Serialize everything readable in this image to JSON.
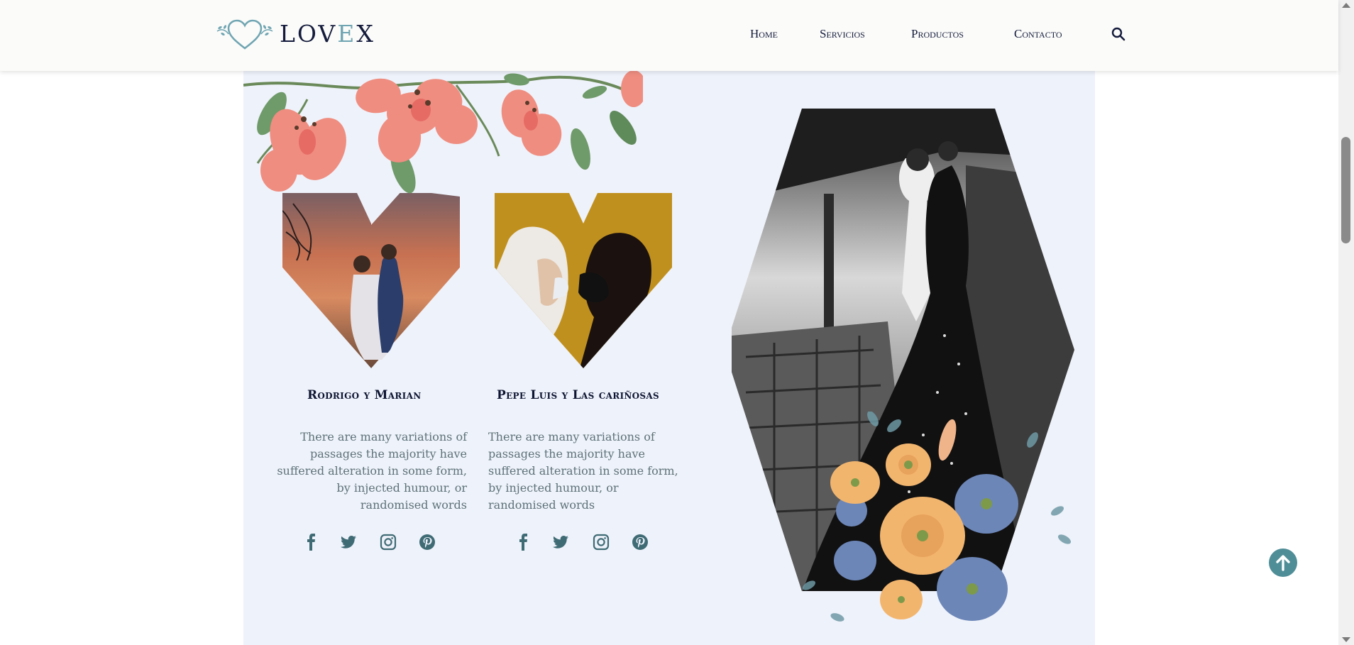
{
  "header": {
    "logo": {
      "text_main": "LOV",
      "text_accent": "E",
      "text_end": "X"
    },
    "nav": [
      {
        "label": "Home"
      },
      {
        "label": "Servicios"
      },
      {
        "label": "Productos"
      },
      {
        "label": "Contacto"
      }
    ],
    "search_icon": "search-icon"
  },
  "couples": [
    {
      "name": "Rodrigo y Marian",
      "description": "There are many variations of passages the majority have suffered alteration in some form, by injected humour, or randomised words",
      "photo_icon": "couple-photo-sunset",
      "social": [
        "facebook-icon",
        "twitter-icon",
        "instagram-icon",
        "pinterest-icon"
      ]
    },
    {
      "name": "Pepe Luis y Las cariñosas",
      "description": "There are many variations of passages the majority have suffered alteration in some form, by injected humour, or randomised words",
      "photo_icon": "couple-photo-masks",
      "social": [
        "facebook-icon",
        "twitter-icon",
        "instagram-icon",
        "pinterest-icon"
      ]
    }
  ],
  "colors": {
    "panel_bg": "#eef2fa",
    "brand_dark": "#141b3c",
    "brand_teal": "#4f8d97",
    "logo_accent": "#6fa5b2",
    "body_text": "#5d7178"
  },
  "back_to_top_icon": "arrow-up-icon"
}
